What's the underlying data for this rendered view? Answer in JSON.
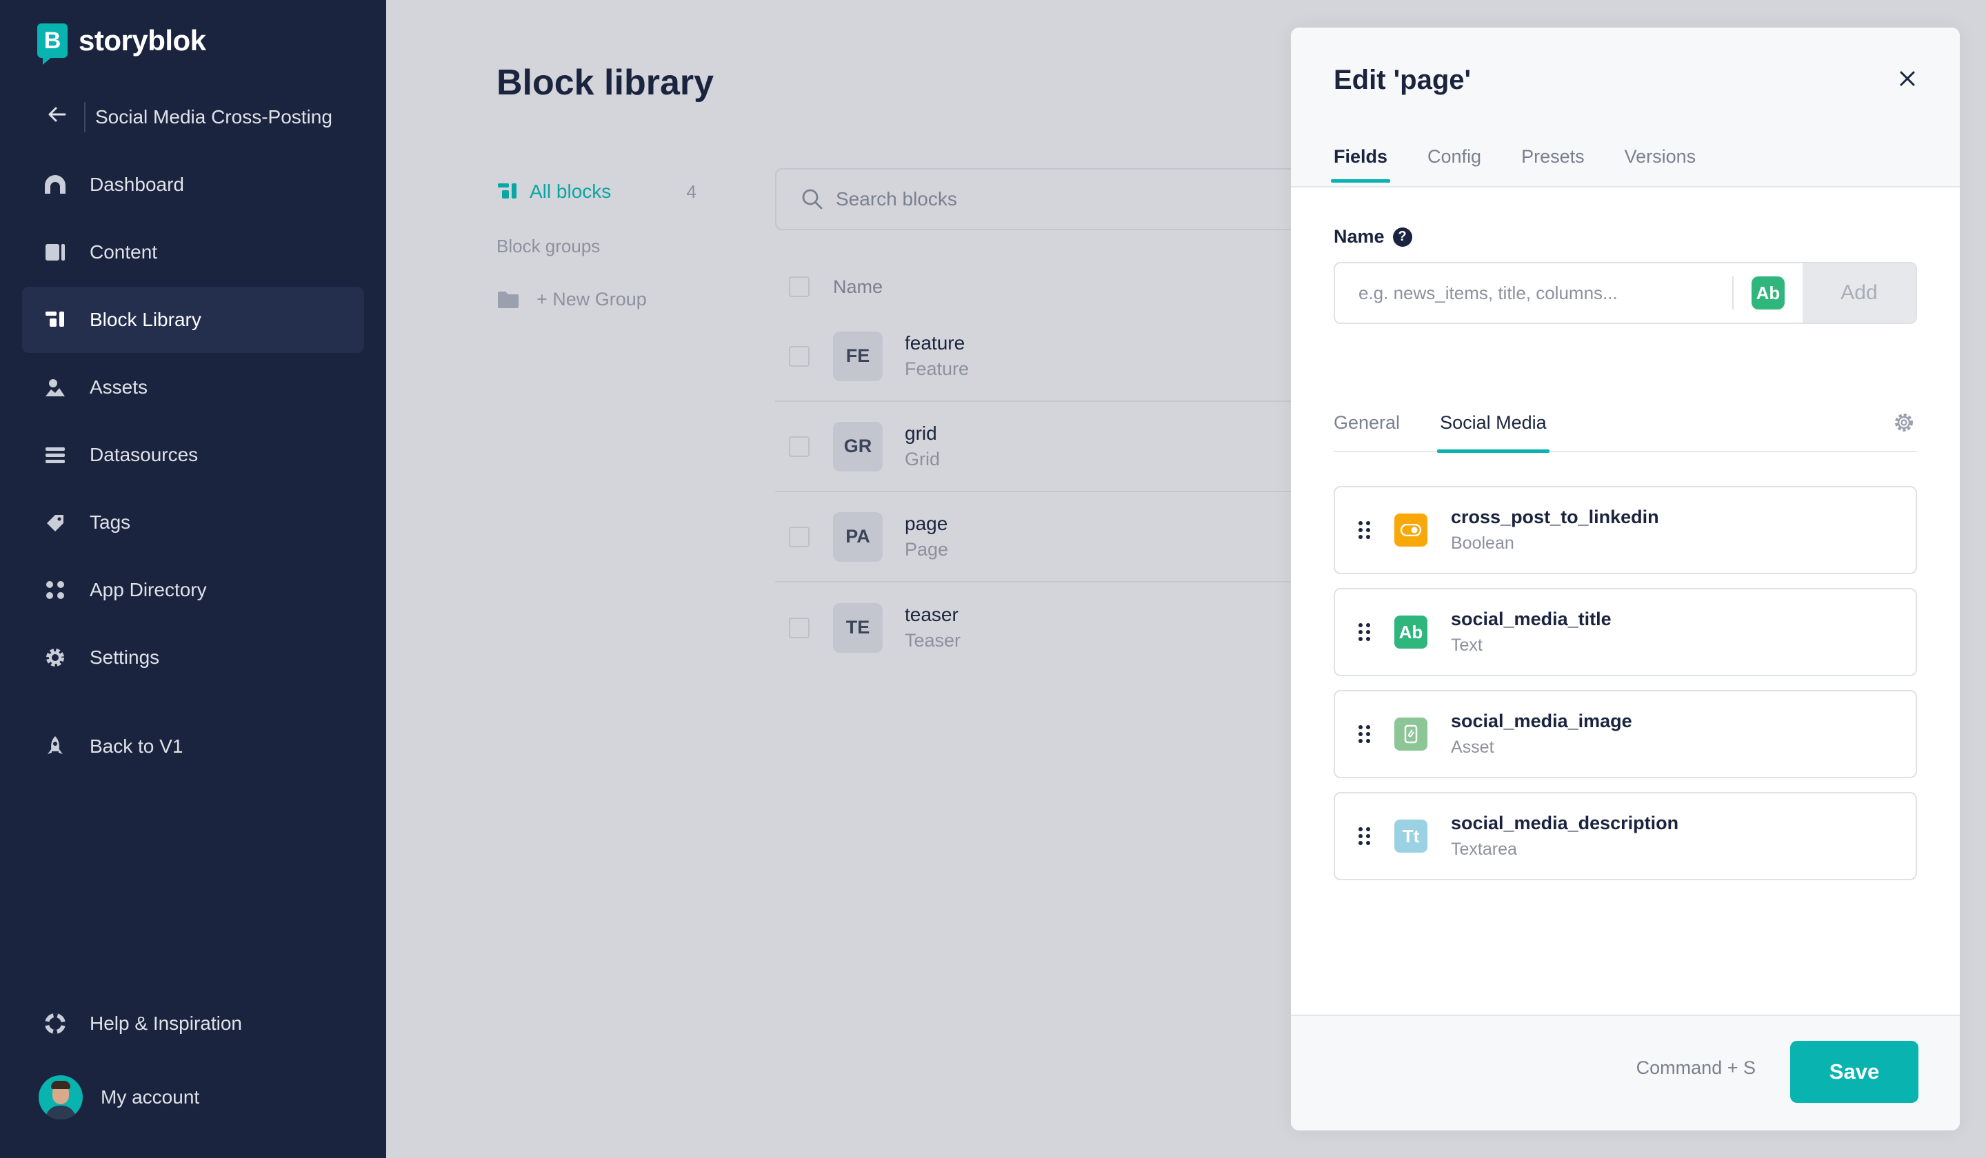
{
  "brand": {
    "name": "storyblok",
    "mark": "B",
    "color": "#09b3af"
  },
  "sidebar": {
    "space_name": "Social Media Cross-Posting",
    "items": [
      {
        "label": "Dashboard",
        "icon": "dashboard-icon"
      },
      {
        "label": "Content",
        "icon": "content-icon"
      },
      {
        "label": "Block Library",
        "icon": "block-library-icon",
        "active": true
      },
      {
        "label": "Assets",
        "icon": "assets-icon"
      },
      {
        "label": "Datasources",
        "icon": "datasources-icon"
      },
      {
        "label": "Tags",
        "icon": "tags-icon"
      },
      {
        "label": "App Directory",
        "icon": "app-directory-icon"
      },
      {
        "label": "Settings",
        "icon": "settings-icon"
      }
    ],
    "back_to_v1": "Back to V1",
    "help": "Help & Inspiration",
    "account": "My account"
  },
  "main": {
    "title": "Block library",
    "filter": {
      "all_label": "All blocks",
      "all_count": "4",
      "groups_label": "Block groups",
      "new_group": "+ New Group"
    },
    "search_placeholder": "Search blocks",
    "table_header": "Name",
    "blocks": [
      {
        "abbr": "FE",
        "name": "feature",
        "display": "Feature"
      },
      {
        "abbr": "GR",
        "name": "grid",
        "display": "Grid"
      },
      {
        "abbr": "PA",
        "name": "page",
        "display": "Page"
      },
      {
        "abbr": "TE",
        "name": "teaser",
        "display": "Teaser"
      }
    ]
  },
  "drawer": {
    "title": "Edit 'page'",
    "tabs": [
      "Fields",
      "Config",
      "Presets",
      "Versions"
    ],
    "active_tab": "Fields",
    "name_label": "Name",
    "help_glyph": "?",
    "name_placeholder": "e.g. news_items, title, columns...",
    "type_badge": "Ab",
    "add_label": "Add",
    "subtabs": [
      "General",
      "Social Media"
    ],
    "active_subtab": "Social Media",
    "fields": [
      {
        "name": "cross_post_to_linkedin",
        "type": "Boolean",
        "icon": "boolean-toggle-icon",
        "color": "#f8a909"
      },
      {
        "name": "social_media_title",
        "type": "Text",
        "icon": "text-icon",
        "glyph": "Ab",
        "color": "#2fb67d"
      },
      {
        "name": "social_media_image",
        "type": "Asset",
        "icon": "asset-icon",
        "color": "#8cc596"
      },
      {
        "name": "social_media_description",
        "type": "Textarea",
        "icon": "textarea-icon",
        "glyph": "Tt",
        "color": "#9ad1e3"
      }
    ],
    "shortcut": "Command + S",
    "save_label": "Save"
  }
}
